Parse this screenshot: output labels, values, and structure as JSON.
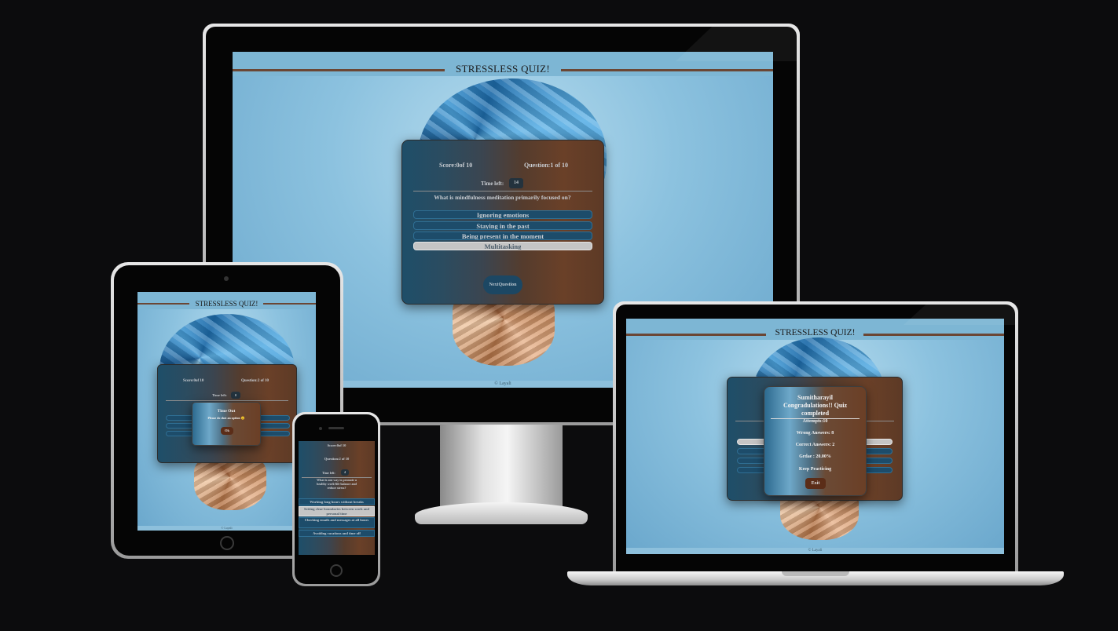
{
  "app": {
    "title": "STRESSLESS QUIZ!",
    "footer": "© Layali"
  },
  "monitor": {
    "score_label": "Score:0of 10",
    "question_label": "Question:1 of 10",
    "time_label": "Time left:",
    "time_value": "14",
    "question": "What is mindfulness meditation primarily focused on?",
    "options": [
      "Ignoring emotions",
      "Staying in the past",
      "Being present in the moment",
      "Multitasking"
    ],
    "selected_index": 3,
    "next_button": "NextQuestion"
  },
  "tablet": {
    "score_label": "Score:0of 10",
    "question_label": "Question:2 of 10",
    "time_label": "Time left:",
    "time_value": "0",
    "modal_title": "Time Out",
    "modal_text": "Please do shot an option 😊",
    "modal_button": "Ok"
  },
  "phone": {
    "score_label": "Score:0of 10",
    "question_label": "Question:2 of 10",
    "time_label": "Time left:",
    "time_value": "4",
    "question": "What is one way to promote a healthy work-life balance and reduce stress?",
    "options": [
      "Working long hours without breaks",
      "Setting clear boundaries between work and personal time",
      "Checking emails and messages at all hours",
      "Avoiding vacations and time off"
    ],
    "selected_index": 1
  },
  "laptop": {
    "result_name": "Sumitharayil",
    "result_heading": "Congradulations!! Quiz completed",
    "attempts": "Attempts:10",
    "wrong": "Wrong Answers: 8",
    "correct": "Correct Answers: 2",
    "grade": "Grdae : 20.00%",
    "message": "Keep Practicing",
    "exit_button": "Exit"
  }
}
